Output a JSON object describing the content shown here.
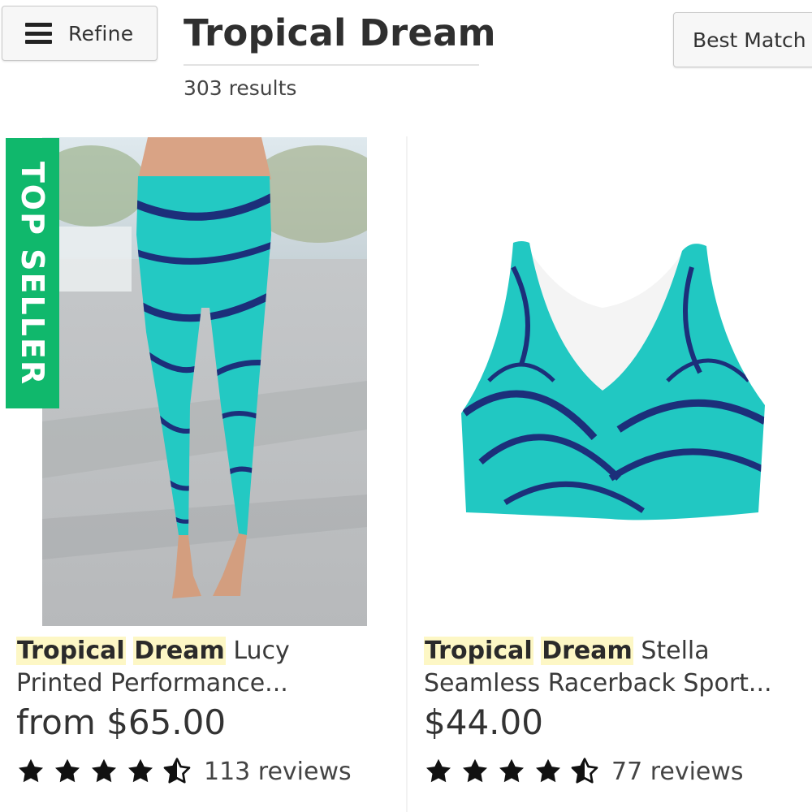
{
  "toolbar": {
    "refine_label": "Refine",
    "sort_label": "Best Match"
  },
  "header": {
    "title": "Tropical Dream",
    "result_count": "303 results"
  },
  "products": [
    {
      "badge": "TOP SELLER",
      "name_highlight_1": "Tropical",
      "name_highlight_2": "Dream",
      "name_rest_line1": "Lucy",
      "name_line2": "Printed Performance...",
      "price": "from $65.00",
      "rating": 4.5,
      "reviews": "113 reviews",
      "image": "tropical-print-leggings-photo",
      "colors": {
        "base": "#1fc6c4",
        "print": "#1c2f7a"
      }
    },
    {
      "name_highlight_1": "Tropical",
      "name_highlight_2": "Dream",
      "name_rest_line1": "Stella",
      "name_line2": "Seamless Racerback Sport...",
      "price": "$44.00",
      "rating": 4.5,
      "reviews": "77 reviews",
      "image": "tropical-print-sports-bra-photo",
      "colors": {
        "base": "#1fc6c4",
        "print": "#1c2f7a"
      }
    }
  ],
  "colors": {
    "badge_green": "#10b86c",
    "highlight": "#fdf7c5",
    "star": "#111111"
  }
}
